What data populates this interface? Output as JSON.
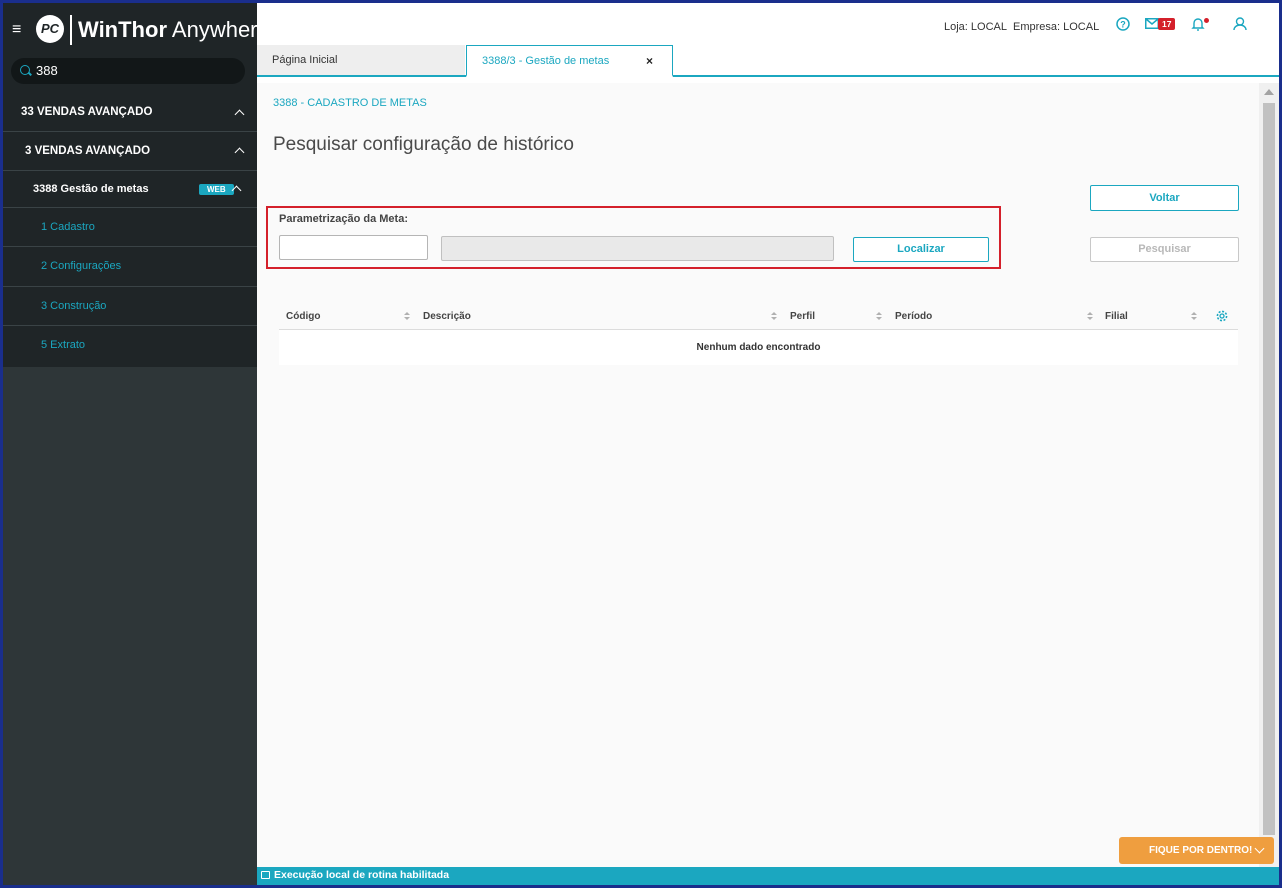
{
  "app": {
    "logo_mark": "PC",
    "brand_bold": "WinThor",
    "brand_light": "Anywhere"
  },
  "search": {
    "value": "388"
  },
  "sidebar": {
    "groups": [
      {
        "label": "33  VENDAS AVANÇADO"
      },
      {
        "label": "3  VENDAS AVANÇADO"
      }
    ],
    "routine": {
      "label": "3388  Gestão de metas",
      "badge": "WEB"
    },
    "items": [
      {
        "label": "1  Cadastro"
      },
      {
        "label": "2  Configurações"
      },
      {
        "label": "3  Construção"
      },
      {
        "label": "5  Extrato"
      }
    ]
  },
  "header": {
    "loja": "Loja: LOCAL",
    "empresa": "Empresa: LOCAL",
    "mail_count": "17"
  },
  "tabs": [
    {
      "label": "Página Inicial"
    },
    {
      "label": "3388/3 - Gestão de metas",
      "close": "×"
    }
  ],
  "main": {
    "breadcrumb": "3388 - CADASTRO DE METAS",
    "title": "Pesquisar configuração de histórico",
    "param_label": "Parametrização da Meta:",
    "localizar": "Localizar",
    "voltar": "Voltar",
    "pesquisar": "Pesquisar"
  },
  "table": {
    "columns": [
      "Código",
      "Descrição",
      "Perfil",
      "Período",
      "Filial"
    ],
    "empty": "Nenhum dado encontrado"
  },
  "status": {
    "text": "Execução local de rotina habilitada"
  },
  "fique": {
    "label": "FIQUE POR DENTRO!"
  },
  "colors": {
    "accent": "#1ba7c0",
    "sidebar": "#2e3638",
    "highlight": "#d4202b",
    "orange": "#ef9e3f"
  }
}
